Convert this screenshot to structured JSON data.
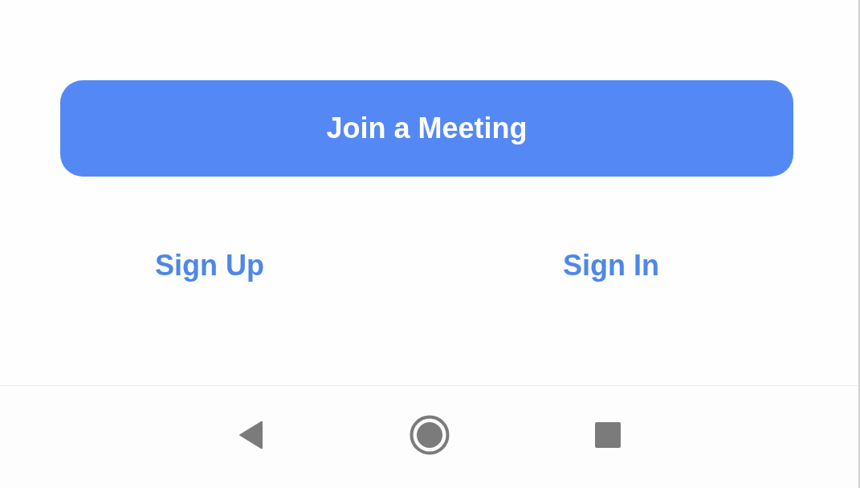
{
  "join_button": {
    "label": "Join a Meeting"
  },
  "links": [
    {
      "label": "Sign Up"
    },
    {
      "label": "Sign In"
    }
  ]
}
